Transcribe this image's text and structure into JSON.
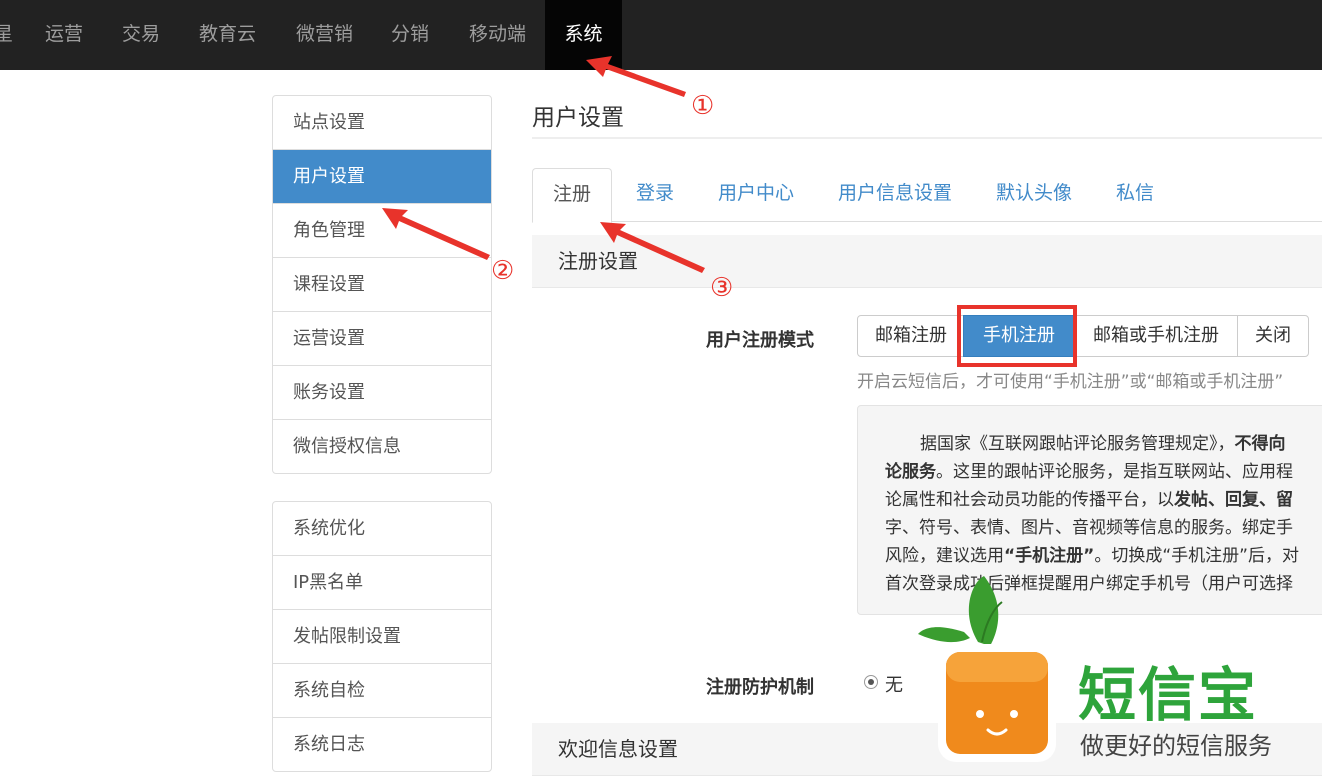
{
  "topnav": {
    "items": [
      "星",
      "运营",
      "交易",
      "教育云",
      "微营销",
      "分销",
      "移动端"
    ],
    "active": "系统"
  },
  "sidebar": {
    "group1": [
      "站点设置",
      "用户设置",
      "角色管理",
      "课程设置",
      "运营设置",
      "账务设置",
      "微信授权信息"
    ],
    "group2": [
      "系统优化",
      "IP黑名单",
      "发帖限制设置",
      "系统自检",
      "系统日志"
    ]
  },
  "main": {
    "title": "用户设置",
    "tabs": [
      "注册",
      "登录",
      "用户中心",
      "用户信息设置",
      "默认头像",
      "私信"
    ],
    "section_register": "注册设置",
    "register_mode_label": "用户注册模式",
    "register_modes": [
      "邮箱注册",
      "手机注册",
      "邮箱或手机注册",
      "关闭"
    ],
    "register_mode_selected": "手机注册",
    "help_text": "开启云短信后，才可使用“手机注册”或“邮箱或手机注册”",
    "notice": {
      "t1": "据国家《互联网跟帖评论服务管理规定》，",
      "b1": "不得向",
      "b2": "论服务",
      "t2": "。这里的跟帖评论服务，是指互联网站、应用程",
      "t3": "论属性和社会动员功能的传播平台，以",
      "b3": "发帖、回复、留",
      "t4": "字、符号、表情、图片、音视频等信息的服务。绑定手",
      "t5": "风险，建议选用",
      "b4": "“手机注册”",
      "t6": "。切换成“手机注册”后，对",
      "t7": "首次登录成功后弹框提醒用户绑定手机号（用户可选择"
    },
    "protection_label": "注册防护机制",
    "protection_option": "无",
    "section_welcome": "欢迎信息设置"
  },
  "annotations": [
    "①",
    "②",
    "③"
  ],
  "logo": {
    "name": "短信宝",
    "slogan": "做更好的短信服务"
  },
  "colors": {
    "nav_bg": "#222222",
    "primary": "#428bca",
    "annotation_red": "#e8332b",
    "logo_green": "#2ea43b",
    "logo_orange": "#f08a1c"
  }
}
